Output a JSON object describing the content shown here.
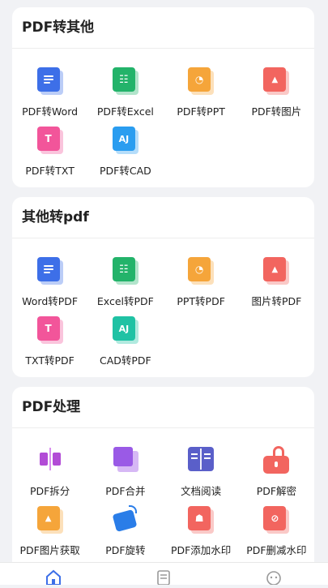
{
  "sections": [
    {
      "title": "PDF转其他",
      "items": [
        {
          "label": "PDF转Word",
          "icon": "word-doc-icon"
        },
        {
          "label": "PDF转Excel",
          "icon": "excel-sheet-icon"
        },
        {
          "label": "PDF转PPT",
          "icon": "ppt-slide-icon"
        },
        {
          "label": "PDF转图片",
          "icon": "image-icon"
        },
        {
          "label": "PDF转TXT",
          "icon": "txt-icon"
        },
        {
          "label": "PDF转CAD",
          "icon": "cad-icon"
        }
      ]
    },
    {
      "title": "其他转pdf",
      "items": [
        {
          "label": "Word转PDF",
          "icon": "word-doc-icon"
        },
        {
          "label": "Excel转PDF",
          "icon": "excel-sheet-icon"
        },
        {
          "label": "PPT转PDF",
          "icon": "ppt-slide-icon"
        },
        {
          "label": "图片转PDF",
          "icon": "image-icon"
        },
        {
          "label": "TXT转PDF",
          "icon": "txt-icon"
        },
        {
          "label": "CAD转PDF",
          "icon": "cad-icon"
        }
      ]
    },
    {
      "title": "PDF处理",
      "items": [
        {
          "label": "PDF拆分",
          "icon": "split-icon"
        },
        {
          "label": "PDF合并",
          "icon": "merge-icon"
        },
        {
          "label": "文档阅读",
          "icon": "read-book-icon"
        },
        {
          "label": "PDF解密",
          "icon": "unlock-icon"
        },
        {
          "label": "PDF图片获取",
          "icon": "extract-image-icon"
        },
        {
          "label": "PDF旋转",
          "icon": "rotate-icon"
        },
        {
          "label": "PDF添加水印",
          "icon": "add-watermark-icon"
        },
        {
          "label": "PDF删减水印",
          "icon": "remove-watermark-icon"
        }
      ]
    }
  ],
  "tabbar": [
    {
      "icon": "home-icon",
      "active": true
    },
    {
      "icon": "document-list-icon",
      "active": false
    },
    {
      "icon": "profile-icon",
      "active": false
    }
  ],
  "colors": {
    "accent": "#3d6fe8",
    "background": "#f1f2f5"
  }
}
